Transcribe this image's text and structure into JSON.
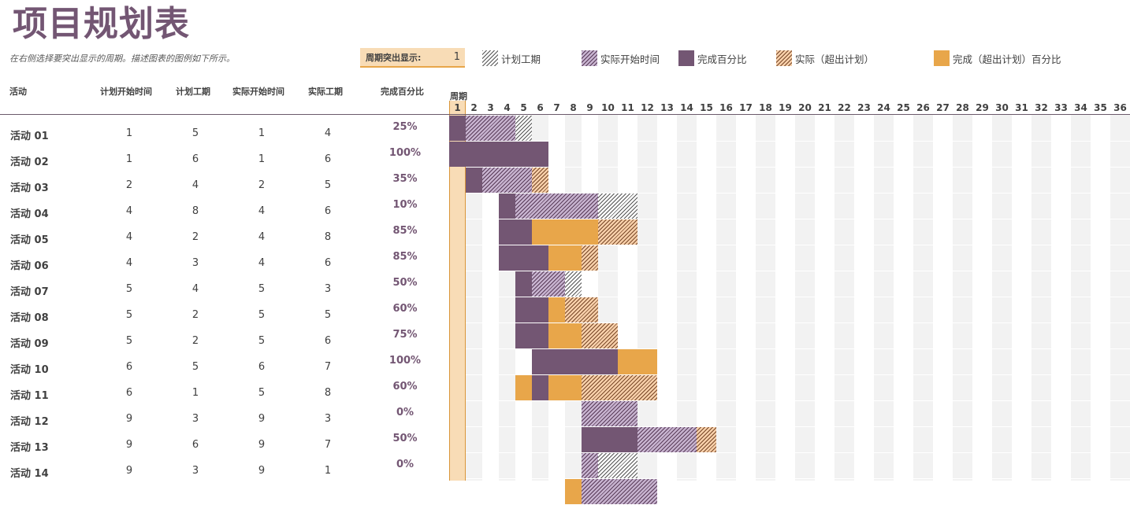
{
  "title": "项目规划表",
  "subtitle": "在右侧选择要突出显示的周期。描述图表的图例如下所示。",
  "highlight": {
    "label": "周期突出显示:",
    "value": "1"
  },
  "legend": [
    {
      "key": "khatch",
      "label": "计划工期"
    },
    {
      "key": "phatch",
      "label": "实际开始时间"
    },
    {
      "key": "dark",
      "label": "完成百分比"
    },
    {
      "key": "ohatch",
      "label": "实际（超出计划）"
    },
    {
      "key": "orange",
      "label": "完成（超出计划）百分比"
    }
  ],
  "columns": {
    "activity": "活动",
    "plan_start": "计划开始时间",
    "plan_duration": "计划工期",
    "actual_start": "实际开始时间",
    "actual_duration": "实际工期",
    "percent_complete": "完成百分比",
    "period": "周期"
  },
  "periods": [
    1,
    2,
    3,
    4,
    5,
    6,
    7,
    8,
    9,
    10,
    11,
    12,
    13,
    14,
    15,
    16,
    17,
    18,
    19,
    20,
    21,
    22,
    23,
    24,
    25,
    26,
    27,
    28,
    29,
    30,
    31,
    32,
    33,
    34,
    35,
    36
  ],
  "colors": {
    "accent": "#735673",
    "orange": "#e8a64a",
    "highlight": "#f8dcb6"
  },
  "rows": [
    {
      "name": "活动 01",
      "plan_start": "1",
      "plan_duration": "5",
      "actual_start": "1",
      "actual_duration": "4",
      "percent": "25%",
      "segments": [
        [
          "dark",
          1,
          1
        ],
        [
          "phatch",
          2,
          4
        ],
        [
          "khatch",
          5,
          5
        ]
      ]
    },
    {
      "name": "活动 02",
      "plan_start": "1",
      "plan_duration": "6",
      "actual_start": "1",
      "actual_duration": "6",
      "percent": "100%",
      "segments": [
        [
          "dark",
          1,
          6
        ]
      ]
    },
    {
      "name": "活动 03",
      "plan_start": "2",
      "plan_duration": "4",
      "actual_start": "2",
      "actual_duration": "5",
      "percent": "35%",
      "segments": [
        [
          "dark",
          2,
          2
        ],
        [
          "phatch",
          3,
          5
        ],
        [
          "ohatch",
          6,
          6
        ]
      ]
    },
    {
      "name": "活动 04",
      "plan_start": "4",
      "plan_duration": "8",
      "actual_start": "4",
      "actual_duration": "6",
      "percent": "10%",
      "segments": [
        [
          "dark",
          4,
          4
        ],
        [
          "phatch",
          5,
          9
        ],
        [
          "khatch",
          10,
          11
        ]
      ]
    },
    {
      "name": "活动 05",
      "plan_start": "4",
      "plan_duration": "2",
      "actual_start": "4",
      "actual_duration": "8",
      "percent": "85%",
      "segments": [
        [
          "dark",
          4,
          5
        ],
        [
          "orange",
          6,
          9
        ],
        [
          "ohatch",
          10,
          11
        ]
      ]
    },
    {
      "name": "活动 06",
      "plan_start": "4",
      "plan_duration": "3",
      "actual_start": "4",
      "actual_duration": "6",
      "percent": "85%",
      "segments": [
        [
          "dark",
          4,
          6
        ],
        [
          "orange",
          7,
          8
        ],
        [
          "ohatch",
          9,
          9
        ]
      ]
    },
    {
      "name": "活动 07",
      "plan_start": "5",
      "plan_duration": "4",
      "actual_start": "5",
      "actual_duration": "3",
      "percent": "50%",
      "segments": [
        [
          "dark",
          5,
          5
        ],
        [
          "phatch",
          6,
          7
        ],
        [
          "khatch",
          8,
          8
        ]
      ]
    },
    {
      "name": "活动 08",
      "plan_start": "5",
      "plan_duration": "2",
      "actual_start": "5",
      "actual_duration": "5",
      "percent": "60%",
      "segments": [
        [
          "dark",
          5,
          6
        ],
        [
          "orange",
          7,
          7
        ],
        [
          "ohatch",
          8,
          9
        ]
      ]
    },
    {
      "name": "活动 09",
      "plan_start": "5",
      "plan_duration": "2",
      "actual_start": "5",
      "actual_duration": "6",
      "percent": "75%",
      "segments": [
        [
          "dark",
          5,
          6
        ],
        [
          "orange",
          7,
          8
        ],
        [
          "ohatch",
          9,
          10
        ]
      ]
    },
    {
      "name": "活动 10",
      "plan_start": "6",
      "plan_duration": "5",
      "actual_start": "6",
      "actual_duration": "7",
      "percent": "100%",
      "segments": [
        [
          "dark",
          6,
          10
        ],
        [
          "orange",
          11,
          12
        ]
      ]
    },
    {
      "name": "活动 11",
      "plan_start": "6",
      "plan_duration": "1",
      "actual_start": "5",
      "actual_duration": "8",
      "percent": "60%",
      "segments": [
        [
          "orange",
          5,
          5
        ],
        [
          "dark",
          6,
          6
        ],
        [
          "orange",
          7,
          8
        ],
        [
          "ohatch",
          9,
          12
        ]
      ]
    },
    {
      "name": "活动 12",
      "plan_start": "9",
      "plan_duration": "3",
      "actual_start": "9",
      "actual_duration": "3",
      "percent": "0%",
      "segments": [
        [
          "phatch",
          9,
          11
        ]
      ]
    },
    {
      "name": "活动 13",
      "plan_start": "9",
      "plan_duration": "6",
      "actual_start": "9",
      "actual_duration": "7",
      "percent": "50%",
      "segments": [
        [
          "dark",
          9,
          11
        ],
        [
          "phatch",
          12,
          14
        ],
        [
          "ohatch",
          15,
          15
        ]
      ]
    },
    {
      "name": "活动 14",
      "plan_start": "9",
      "plan_duration": "3",
      "actual_start": "9",
      "actual_duration": "1",
      "percent": "0%",
      "segments": [
        [
          "phatch",
          9,
          9
        ],
        [
          "khatch",
          10,
          11
        ]
      ]
    },
    {
      "name": "",
      "plan_start": "",
      "plan_duration": "",
      "actual_start": "",
      "actual_duration": "",
      "percent": "",
      "segments": [
        [
          "orange",
          8,
          8
        ],
        [
          "phatch",
          9,
          12
        ]
      ]
    }
  ]
}
